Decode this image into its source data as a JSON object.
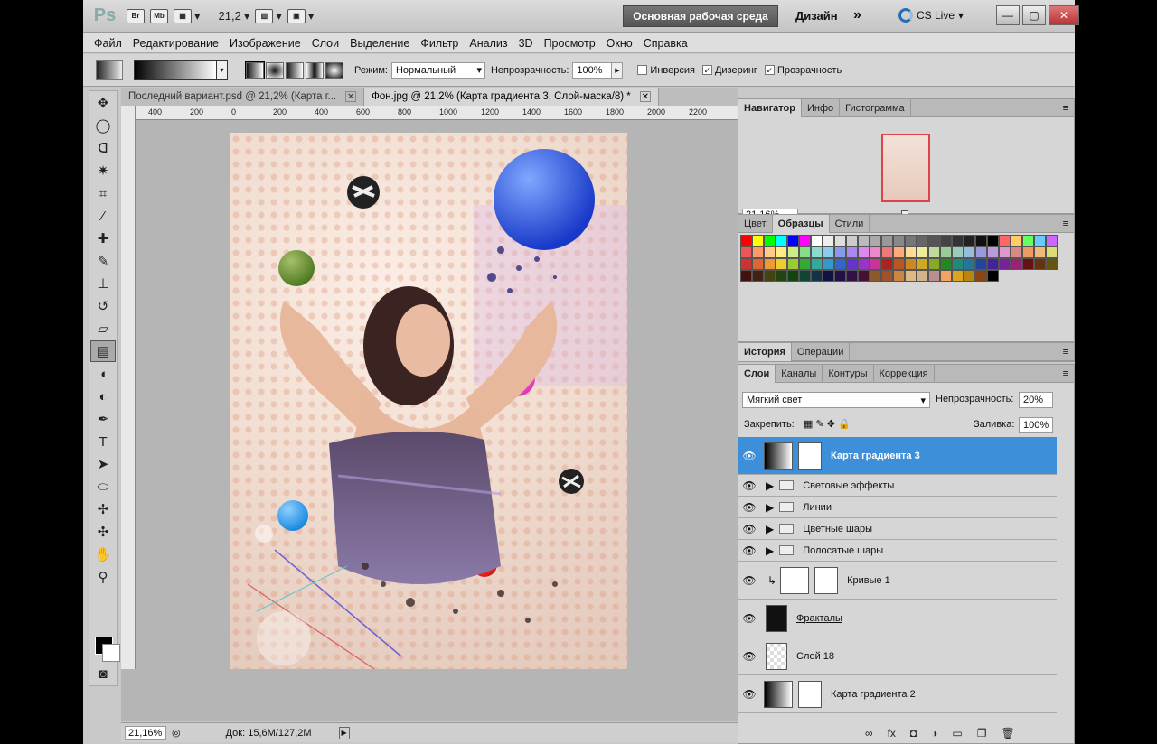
{
  "app": {
    "logo": "Ps",
    "bridge": "Br",
    "minibridge": "Mb",
    "zoom_value": "21,2",
    "workspace": "Основная рабочая среда",
    "design": "Дизайн",
    "more": "»",
    "cslive": "CS Live",
    "minimize": "—",
    "restore": "▢",
    "close": "✕"
  },
  "menu": [
    "Файл",
    "Редактирование",
    "Изображение",
    "Слои",
    "Выделение",
    "Фильтр",
    "Анализ",
    "3D",
    "Просмотр",
    "Окно",
    "Справка"
  ],
  "options": {
    "mode_label": "Режим:",
    "mode_value": "Нормальный",
    "opacity_label": "Непрозрачность:",
    "opacity_value": "100%",
    "invert": "Инверсия",
    "dither": "Дизеринг",
    "transparency": "Прозрачность"
  },
  "tabs": [
    {
      "label": "Последний вариант.psd @ 21,2% (Карта г..."
    },
    {
      "label": "Фон.jpg @ 21,2% (Карта градиента 3, Слой-маска/8) *"
    }
  ],
  "ruler_labels": [
    "400",
    "200",
    "0",
    "200",
    "400",
    "600",
    "800",
    "1000",
    "1200",
    "1400",
    "1600",
    "1800",
    "2000",
    "2200"
  ],
  "status": {
    "zoom": "21,16%",
    "doc": "Док: 15,6M/127,2M"
  },
  "panels": {
    "navigator_tabs": [
      "Навигатор",
      "Инфо",
      "Гистограмма"
    ],
    "navigator_zoom": "21.16%",
    "swatch_tabs": [
      "Цвет",
      "Образцы",
      "Стили"
    ],
    "history_tabs": [
      "История",
      "Операции"
    ],
    "layer_tabs": [
      "Слои",
      "Каналы",
      "Контуры",
      "Коррекция"
    ],
    "blend_mode": "Мягкий свет",
    "opacity_label": "Непрозрачность:",
    "opacity_value": "20%",
    "lock_label": "Закрепить:",
    "fill_label": "Заливка:",
    "fill_value": "100%",
    "layers": [
      {
        "name": "Карта градиента 3",
        "type": "adjustment",
        "selected": true
      },
      {
        "name": "Световые эффекты",
        "type": "group"
      },
      {
        "name": "Линии",
        "type": "group"
      },
      {
        "name": "Цветные шары",
        "type": "group"
      },
      {
        "name": "Полосатые шары",
        "type": "group"
      },
      {
        "name": "Кривые 1",
        "type": "adjustment"
      },
      {
        "name": "Фракталы",
        "type": "layer"
      },
      {
        "name": "Слой 18",
        "type": "layer"
      },
      {
        "name": "Карта градиента 2",
        "type": "adjustment"
      }
    ]
  },
  "colors": {
    "accent": "#3d8fd9",
    "workspace_btn": "#5a5a5a"
  }
}
